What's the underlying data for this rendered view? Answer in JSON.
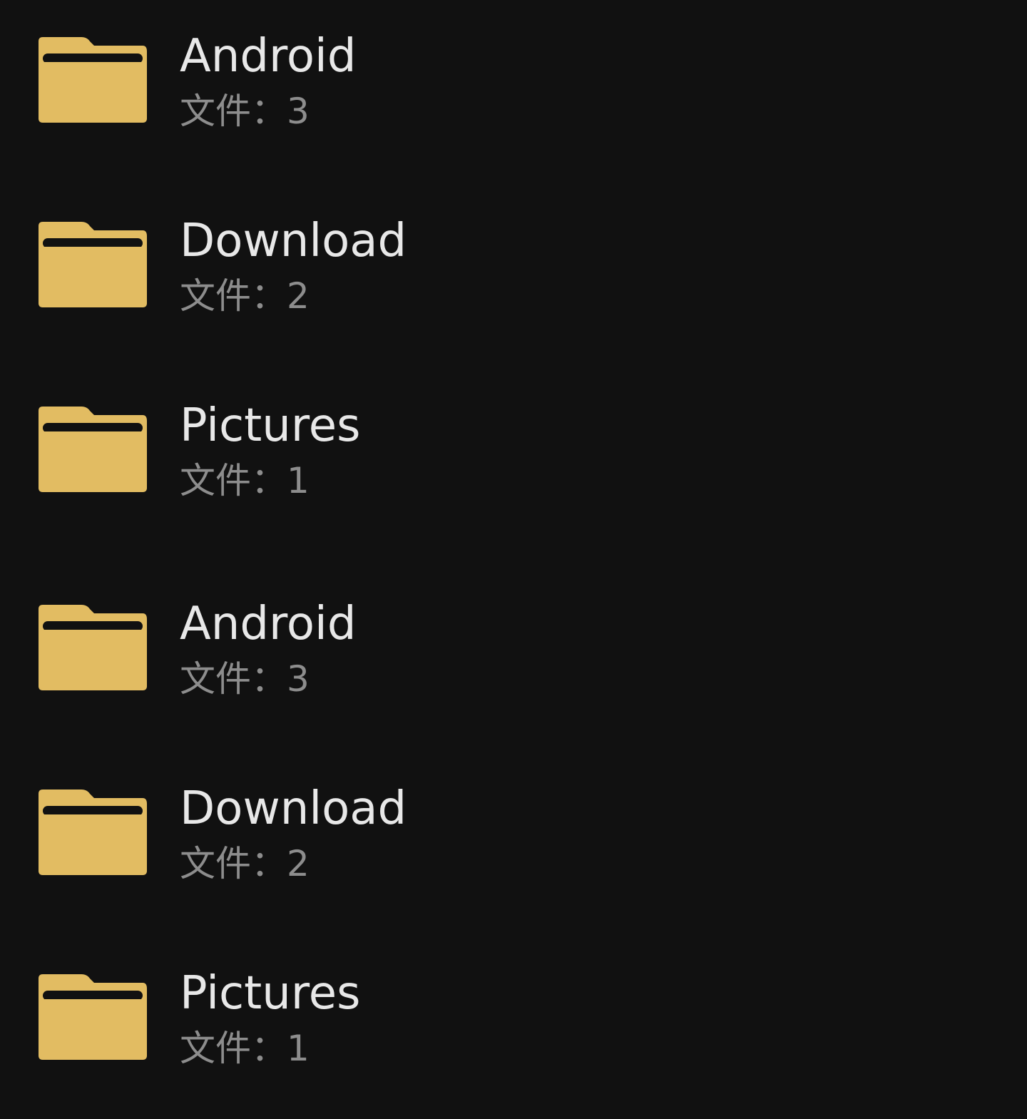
{
  "folders": [
    {
      "name": "Android",
      "count_text": "文件：3",
      "icon": "folder-icon"
    },
    {
      "name": "Download",
      "count_text": "文件：2",
      "icon": "folder-icon"
    },
    {
      "name": "Pictures",
      "count_text": "文件：1",
      "icon": "folder-icon"
    },
    {
      "name": "Android",
      "count_text": "文件：3",
      "icon": "folder-icon"
    },
    {
      "name": "Download",
      "count_text": "文件：2",
      "icon": "folder-icon"
    },
    {
      "name": "Pictures",
      "count_text": "文件：1",
      "icon": "folder-icon"
    }
  ],
  "colors": {
    "background": "#111111",
    "folder": "#E2BC62",
    "folder_line": "#111111",
    "title": "#E8E8E8",
    "subtitle": "#8D8D8D"
  }
}
